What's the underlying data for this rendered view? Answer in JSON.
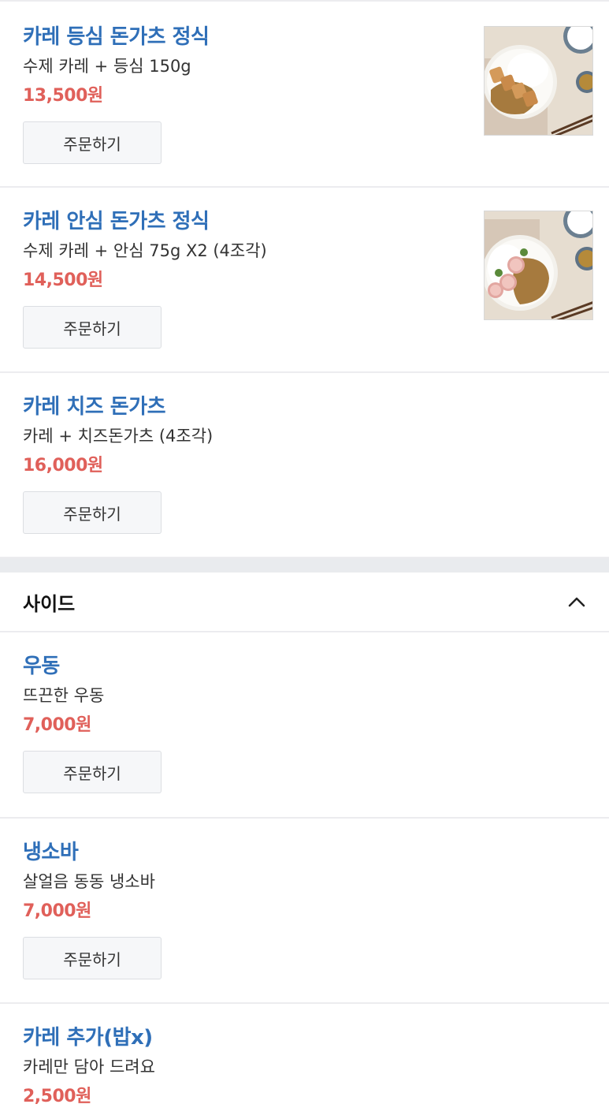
{
  "order_label": "주문하기",
  "main_items": [
    {
      "name": "카레 등심 돈가츠 정식",
      "desc": "수제 카레 + 등심 150g",
      "price": "13,500원",
      "image": "curry-loin-cutlet-photo"
    },
    {
      "name": "카레 안심 돈가츠 정식",
      "desc": "수제 카레 + 안심 75g X2 (4조각)",
      "price": "14,500원",
      "image": "curry-tenderloin-cutlet-photo"
    },
    {
      "name": "카레 치즈 돈가츠",
      "desc": "카레 + 치즈돈가츠 (4조각)",
      "price": "16,000원"
    }
  ],
  "side_section": {
    "title": "사이드",
    "toggle_icon": "chevron-up-icon",
    "items": [
      {
        "name": "우동",
        "desc": "뜨끈한 우동",
        "price": "7,000원"
      },
      {
        "name": "냉소바",
        "desc": "살얼음 동동 냉소바",
        "price": "7,000원"
      },
      {
        "name": "카레 추가(밥x)",
        "desc": "카레만 담아 드려요",
        "price": "2,500원"
      }
    ]
  },
  "colors": {
    "name": "#2f6fb8",
    "price": "#e0605a",
    "divider": "#ececef",
    "section_gap": "#e9ebee"
  }
}
